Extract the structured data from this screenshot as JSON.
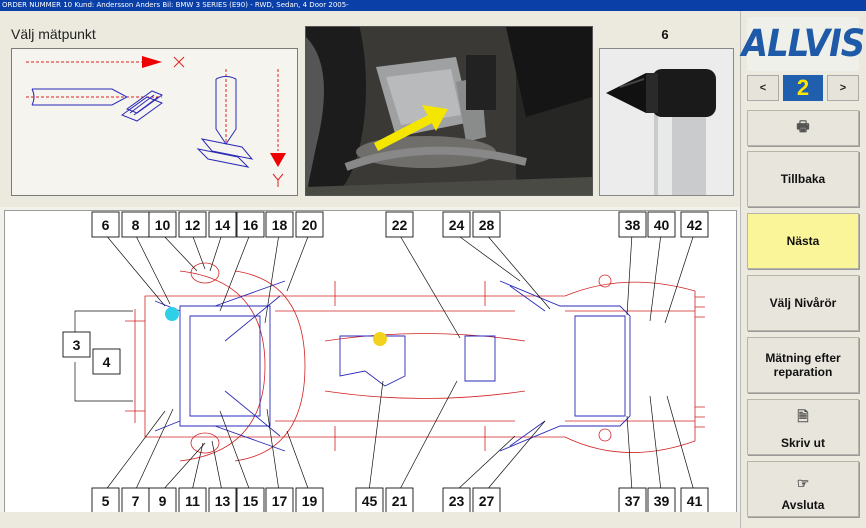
{
  "header": {
    "text": "ORDER NUMMER  10    Kund: Andersson Anders    Bil: BMW  3 SERIES (E90) - RWD, Sedan, 4 Door  2005-"
  },
  "instruction": {
    "title": "Välj mätpunkt"
  },
  "tool": {
    "number": "6"
  },
  "brand": {
    "logo_text": "ALLVIS"
  },
  "pager": {
    "prev": "<",
    "page": "2",
    "next": ">"
  },
  "buttons": {
    "back": "Tillbaka",
    "next": "Nästa",
    "select_levels": "Välj Nivårör",
    "measure_after": "Mätning efter reparation",
    "print": "Skriv ut",
    "quit": "Avsluta"
  },
  "diagram": {
    "top_labels": [
      "6",
      "8",
      "10",
      "12",
      "14",
      "16",
      "18",
      "20",
      "22",
      "24",
      "28",
      "38",
      "40",
      "42"
    ],
    "side_labels": [
      "3",
      "4"
    ],
    "bottom_labels": [
      "5",
      "7",
      "9",
      "11",
      "13",
      "15",
      "17",
      "19",
      "45",
      "21",
      "23",
      "27",
      "37",
      "39",
      "41"
    ]
  },
  "colors": {
    "accent": "#1f5fae",
    "active_button": "#fbf59a",
    "frame_red": "#d22222",
    "frame_blue": "#2a2ab8"
  }
}
